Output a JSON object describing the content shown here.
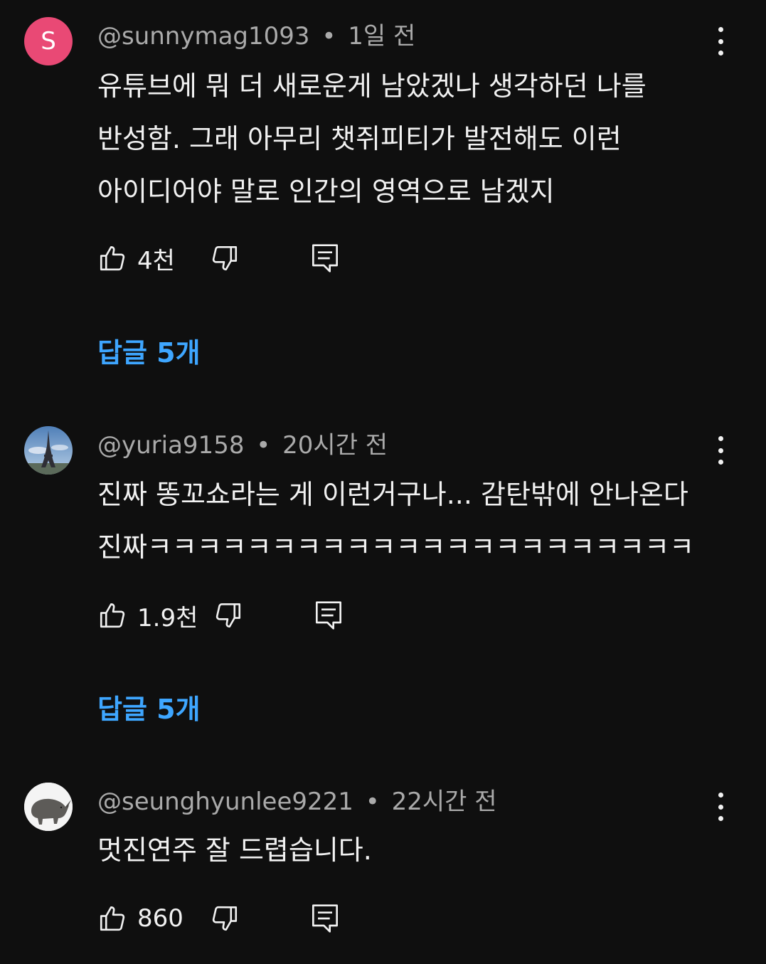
{
  "comments": [
    {
      "handle": "@sunnymag1093",
      "separator": "•",
      "time": "1일 전",
      "avatar_letter": "S",
      "avatar_color": "#e94975",
      "lines": [
        "유튜브에 뭐 더 새로운게 남았겠나 생각하던 나를",
        "반성함. 그래 아무리 챗쥐피티가 발전해도 이런",
        "아이디어야 말로 인간의 영역으로 남겠지"
      ],
      "likes": "4천",
      "replies_label": "답글 5개"
    },
    {
      "handle": "@yuria9158",
      "separator": "•",
      "time": "20시간 전",
      "avatar_icon": "eiffel-tower-photo",
      "lines": [
        "진짜 똥꼬쇼라는 게 이런거구나... 감탄밖에 안나온다",
        "진짜ㅋㅋㅋㅋㅋㅋㅋㅋㅋㅋㅋㅋㅋㅋㅋㅋㅋㅋㅋㅋㅋㅋ"
      ],
      "likes": "1.9천",
      "replies_label": "답글 5개"
    },
    {
      "handle": "@seunghyunlee9221",
      "separator": "•",
      "time": "22시간 전",
      "avatar_icon": "rhino-photo",
      "lines": [
        "멋진연주 잘 드렵습니다."
      ],
      "likes": "860"
    }
  ],
  "colors": {
    "background": "#0f0f0f",
    "text": "#f1f1f1",
    "meta": "#aaaaaa",
    "link": "#3ea6ff"
  }
}
